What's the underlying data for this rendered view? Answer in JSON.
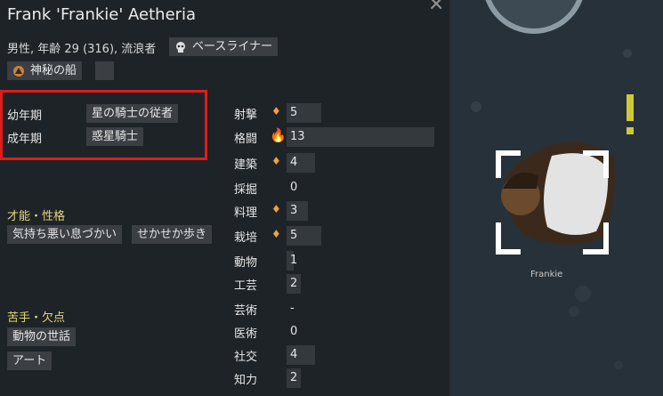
{
  "header": {
    "name": "Frank 'Frankie' Aetheria",
    "subtitle": "男性, 年齢 29 (316), 流浪者"
  },
  "chips": {
    "ideology": "ベースライナー",
    "faction": "神秘の船"
  },
  "backstory": {
    "childhood_label": "幼年期",
    "childhood_value": "星の騎士の従者",
    "adulthood_label": "成年期",
    "adulthood_value": "惑星騎士"
  },
  "traits": {
    "heading": "才能・性格",
    "items": [
      "気持ち悪い息づかい",
      "せかせか歩き"
    ]
  },
  "incapable": {
    "heading": "苦手・欠点",
    "items": [
      "動物の世話",
      "アート"
    ]
  },
  "skills": [
    {
      "name": "射撃",
      "value": "5",
      "level": 5,
      "passion": 1
    },
    {
      "name": "格闘",
      "value": "13",
      "level": 13,
      "passion": 2
    },
    {
      "name": "建築",
      "value": "4",
      "level": 4,
      "passion": 1
    },
    {
      "name": "採掘",
      "value": "0",
      "level": 0,
      "passion": 0
    },
    {
      "name": "料理",
      "value": "3",
      "level": 3,
      "passion": 1
    },
    {
      "name": "栽培",
      "value": "5",
      "level": 5,
      "passion": 1
    },
    {
      "name": "動物",
      "value": "1",
      "level": 1,
      "passion": 0
    },
    {
      "name": "工芸",
      "value": "2",
      "level": 2,
      "passion": 0
    },
    {
      "name": "芸術",
      "value": "-",
      "level": 0,
      "passion": 0
    },
    {
      "name": "医術",
      "value": "0",
      "level": 0,
      "passion": 0
    },
    {
      "name": "社交",
      "value": "4",
      "level": 4,
      "passion": 0
    },
    {
      "name": "知力",
      "value": "2",
      "level": 2,
      "passion": 0
    }
  ],
  "map": {
    "pawn_label": "Frankie"
  },
  "colors": {
    "passion": "#f0a23c",
    "heading": "#e7d67a",
    "highlight": "#e01c1c"
  }
}
